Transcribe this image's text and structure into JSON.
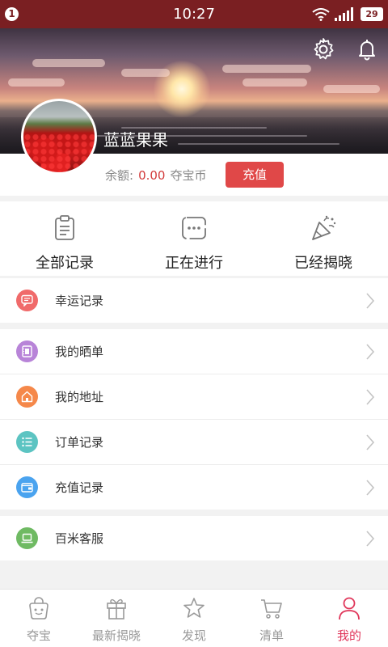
{
  "status_bar": {
    "notification_count": "1",
    "time": "10:27",
    "battery": "29"
  },
  "header": {
    "settings_icon": "gear-icon",
    "notification_icon": "bell-icon"
  },
  "profile": {
    "username": "蓝蓝果果",
    "balance_label": "余额:",
    "balance_value": "0.00",
    "currency": "夺宝币",
    "recharge_label": "充值"
  },
  "quick_actions": [
    {
      "label": "全部记录",
      "icon": "clipboard-icon"
    },
    {
      "label": "正在进行",
      "icon": "chat-dots-icon"
    },
    {
      "label": "已经揭晓",
      "icon": "party-popper-icon"
    }
  ],
  "menu": [
    {
      "label": "幸运记录",
      "icon": "message-icon",
      "color": "#f06a6a"
    },
    {
      "label": "我的晒单",
      "icon": "film-icon",
      "color": "#b884d8"
    },
    {
      "label": "我的地址",
      "icon": "home-icon",
      "color": "#f5884a"
    },
    {
      "label": "订单记录",
      "icon": "list-icon",
      "color": "#5cc4c2"
    },
    {
      "label": "充值记录",
      "icon": "wallet-icon",
      "color": "#4aa3ef"
    },
    {
      "label": "百米客服",
      "icon": "laptop-icon",
      "color": "#6fba63"
    }
  ],
  "tabs": [
    {
      "label": "夺宝",
      "icon": "bag-icon",
      "active": false
    },
    {
      "label": "最新揭晓",
      "icon": "gift-icon",
      "active": false
    },
    {
      "label": "发现",
      "icon": "star-icon",
      "active": false
    },
    {
      "label": "清单",
      "icon": "cart-icon",
      "active": false
    },
    {
      "label": "我的",
      "icon": "user-icon",
      "active": true
    }
  ],
  "colors": {
    "status_bar": "#7a1f22",
    "accent": "#e0365a",
    "recharge": "#e04848"
  }
}
